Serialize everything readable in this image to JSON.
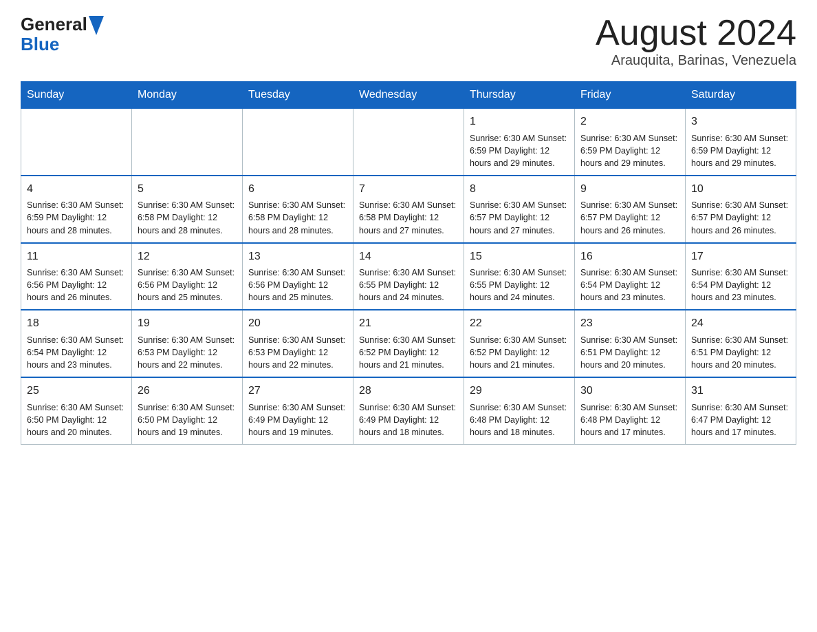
{
  "header": {
    "logo_general": "General",
    "logo_blue": "Blue",
    "month_title": "August 2024",
    "location": "Arauquita, Barinas, Venezuela"
  },
  "days_of_week": [
    "Sunday",
    "Monday",
    "Tuesday",
    "Wednesday",
    "Thursday",
    "Friday",
    "Saturday"
  ],
  "weeks": [
    [
      {
        "day": "",
        "info": ""
      },
      {
        "day": "",
        "info": ""
      },
      {
        "day": "",
        "info": ""
      },
      {
        "day": "",
        "info": ""
      },
      {
        "day": "1",
        "info": "Sunrise: 6:30 AM\nSunset: 6:59 PM\nDaylight: 12 hours and 29 minutes."
      },
      {
        "day": "2",
        "info": "Sunrise: 6:30 AM\nSunset: 6:59 PM\nDaylight: 12 hours and 29 minutes."
      },
      {
        "day": "3",
        "info": "Sunrise: 6:30 AM\nSunset: 6:59 PM\nDaylight: 12 hours and 29 minutes."
      }
    ],
    [
      {
        "day": "4",
        "info": "Sunrise: 6:30 AM\nSunset: 6:59 PM\nDaylight: 12 hours and 28 minutes."
      },
      {
        "day": "5",
        "info": "Sunrise: 6:30 AM\nSunset: 6:58 PM\nDaylight: 12 hours and 28 minutes."
      },
      {
        "day": "6",
        "info": "Sunrise: 6:30 AM\nSunset: 6:58 PM\nDaylight: 12 hours and 28 minutes."
      },
      {
        "day": "7",
        "info": "Sunrise: 6:30 AM\nSunset: 6:58 PM\nDaylight: 12 hours and 27 minutes."
      },
      {
        "day": "8",
        "info": "Sunrise: 6:30 AM\nSunset: 6:57 PM\nDaylight: 12 hours and 27 minutes."
      },
      {
        "day": "9",
        "info": "Sunrise: 6:30 AM\nSunset: 6:57 PM\nDaylight: 12 hours and 26 minutes."
      },
      {
        "day": "10",
        "info": "Sunrise: 6:30 AM\nSunset: 6:57 PM\nDaylight: 12 hours and 26 minutes."
      }
    ],
    [
      {
        "day": "11",
        "info": "Sunrise: 6:30 AM\nSunset: 6:56 PM\nDaylight: 12 hours and 26 minutes."
      },
      {
        "day": "12",
        "info": "Sunrise: 6:30 AM\nSunset: 6:56 PM\nDaylight: 12 hours and 25 minutes."
      },
      {
        "day": "13",
        "info": "Sunrise: 6:30 AM\nSunset: 6:56 PM\nDaylight: 12 hours and 25 minutes."
      },
      {
        "day": "14",
        "info": "Sunrise: 6:30 AM\nSunset: 6:55 PM\nDaylight: 12 hours and 24 minutes."
      },
      {
        "day": "15",
        "info": "Sunrise: 6:30 AM\nSunset: 6:55 PM\nDaylight: 12 hours and 24 minutes."
      },
      {
        "day": "16",
        "info": "Sunrise: 6:30 AM\nSunset: 6:54 PM\nDaylight: 12 hours and 23 minutes."
      },
      {
        "day": "17",
        "info": "Sunrise: 6:30 AM\nSunset: 6:54 PM\nDaylight: 12 hours and 23 minutes."
      }
    ],
    [
      {
        "day": "18",
        "info": "Sunrise: 6:30 AM\nSunset: 6:54 PM\nDaylight: 12 hours and 23 minutes."
      },
      {
        "day": "19",
        "info": "Sunrise: 6:30 AM\nSunset: 6:53 PM\nDaylight: 12 hours and 22 minutes."
      },
      {
        "day": "20",
        "info": "Sunrise: 6:30 AM\nSunset: 6:53 PM\nDaylight: 12 hours and 22 minutes."
      },
      {
        "day": "21",
        "info": "Sunrise: 6:30 AM\nSunset: 6:52 PM\nDaylight: 12 hours and 21 minutes."
      },
      {
        "day": "22",
        "info": "Sunrise: 6:30 AM\nSunset: 6:52 PM\nDaylight: 12 hours and 21 minutes."
      },
      {
        "day": "23",
        "info": "Sunrise: 6:30 AM\nSunset: 6:51 PM\nDaylight: 12 hours and 20 minutes."
      },
      {
        "day": "24",
        "info": "Sunrise: 6:30 AM\nSunset: 6:51 PM\nDaylight: 12 hours and 20 minutes."
      }
    ],
    [
      {
        "day": "25",
        "info": "Sunrise: 6:30 AM\nSunset: 6:50 PM\nDaylight: 12 hours and 20 minutes."
      },
      {
        "day": "26",
        "info": "Sunrise: 6:30 AM\nSunset: 6:50 PM\nDaylight: 12 hours and 19 minutes."
      },
      {
        "day": "27",
        "info": "Sunrise: 6:30 AM\nSunset: 6:49 PM\nDaylight: 12 hours and 19 minutes."
      },
      {
        "day": "28",
        "info": "Sunrise: 6:30 AM\nSunset: 6:49 PM\nDaylight: 12 hours and 18 minutes."
      },
      {
        "day": "29",
        "info": "Sunrise: 6:30 AM\nSunset: 6:48 PM\nDaylight: 12 hours and 18 minutes."
      },
      {
        "day": "30",
        "info": "Sunrise: 6:30 AM\nSunset: 6:48 PM\nDaylight: 12 hours and 17 minutes."
      },
      {
        "day": "31",
        "info": "Sunrise: 6:30 AM\nSunset: 6:47 PM\nDaylight: 12 hours and 17 minutes."
      }
    ]
  ]
}
